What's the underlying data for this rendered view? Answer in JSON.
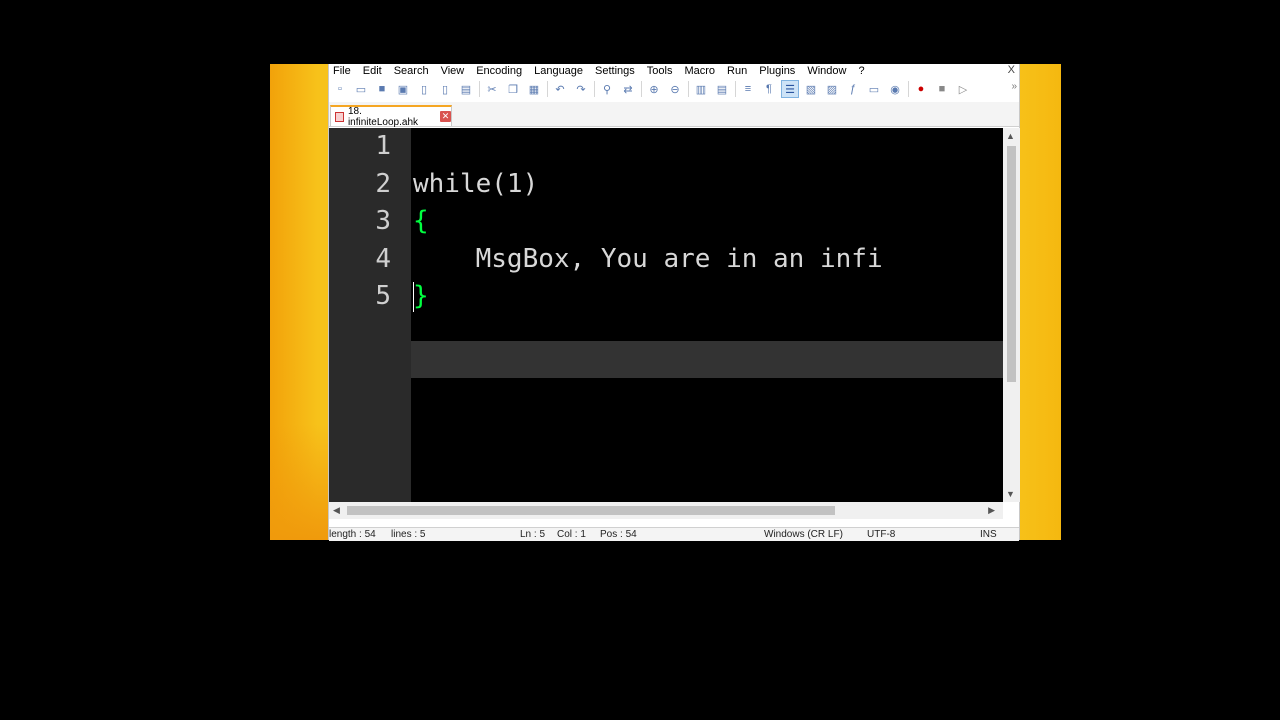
{
  "menubar": {
    "items": [
      "File",
      "Edit",
      "Search",
      "View",
      "Encoding",
      "Language",
      "Settings",
      "Tools",
      "Macro",
      "Run",
      "Plugins",
      "Window",
      "?"
    ],
    "close_glyph": "X"
  },
  "tab": {
    "label": "18. infiniteLoop.ahk"
  },
  "editor": {
    "line_numbers": [
      "1",
      "2",
      "3",
      "4",
      "5"
    ],
    "lines": [
      "",
      "while(1)",
      "{",
      "    MsgBox, You are in an infi",
      "}"
    ]
  },
  "status": {
    "length": "length : 54",
    "lines": "lines : 5",
    "ln": "Ln : 5",
    "col": "Col : 1",
    "pos": "Pos : 54",
    "eol": "Windows (CR LF)",
    "encoding": "UTF-8",
    "mode": "INS"
  },
  "colors": {
    "brace": "#00ff40",
    "editor_bg": "#000000",
    "gutter_bg": "#2a2a2a",
    "desktop": "#f7c21a"
  }
}
